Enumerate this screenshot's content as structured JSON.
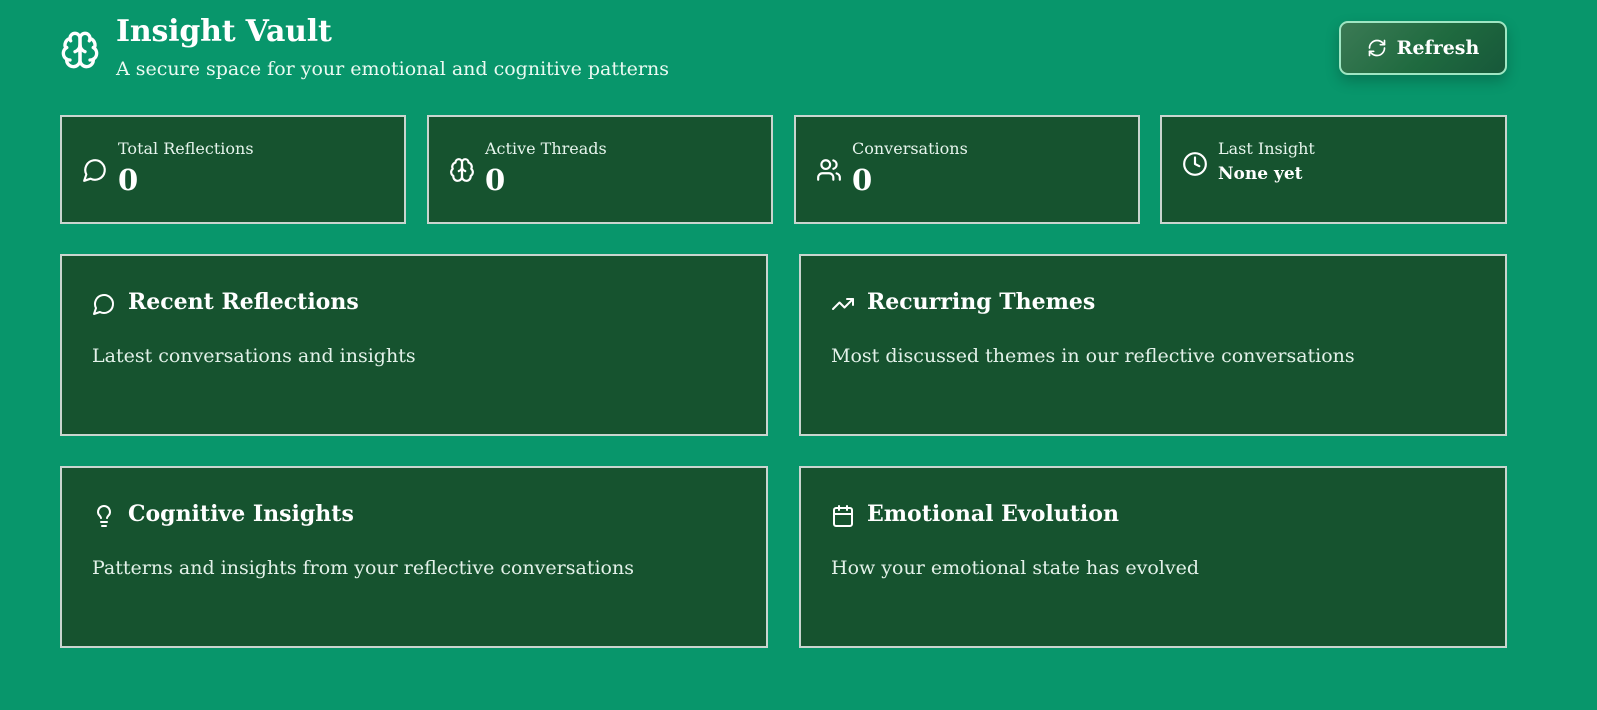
{
  "header": {
    "title": "Insight Vault",
    "subtitle": "A secure space for your emotional and cognitive patterns",
    "refresh_label": "Refresh",
    "icon": "brain-icon"
  },
  "stats": [
    {
      "label": "Total Reflections",
      "value": "0",
      "icon": "message-circle-icon"
    },
    {
      "label": "Active Threads",
      "value": "0",
      "icon": "brain-icon"
    },
    {
      "label": "Conversations",
      "value": "0",
      "icon": "users-icon"
    },
    {
      "label": "Last Insight",
      "value": "None yet",
      "icon": "clock-icon"
    }
  ],
  "panels": [
    {
      "title": "Recent Reflections",
      "description": "Latest conversations and insights",
      "icon": "message-circle-icon"
    },
    {
      "title": "Recurring Themes",
      "description": "Most discussed themes in our reflective conversations",
      "icon": "trending-up-icon"
    },
    {
      "title": "Cognitive Insights",
      "description": "Patterns and insights from your reflective conversations",
      "icon": "lightbulb-icon"
    },
    {
      "title": "Emotional Evolution",
      "description": "How your emotional state has evolved",
      "icon": "calendar-icon"
    }
  ],
  "colors": {
    "background": "#08966b",
    "card": "#16532f",
    "card_border": "#c9d5cf",
    "button_border": "#9fe6c3"
  }
}
